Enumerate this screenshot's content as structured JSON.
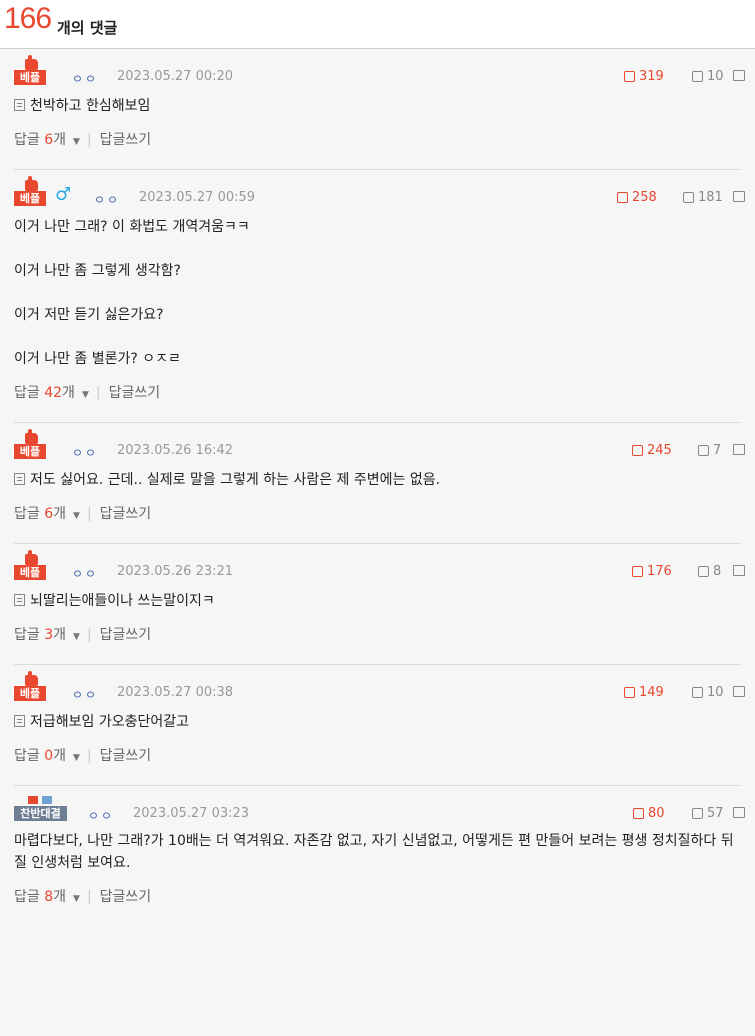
{
  "header": {
    "count": "166",
    "label": "개의 댓글"
  },
  "ui": {
    "reply_label": "답글",
    "reply_unit": "개",
    "write_reply": "답글쓰기",
    "best_badge": "베플",
    "flag_badge": "찬반대결"
  },
  "comments": [
    {
      "badge": "best",
      "gender": "",
      "nick": "ㅇㅇ",
      "date": "2023.05.27 00:20",
      "likes": "319",
      "dislikes": "10",
      "memo": true,
      "lines": [
        "천박하고 한심해보임"
      ],
      "replies": "6"
    },
    {
      "badge": "best",
      "gender": "♂",
      "nick": "ㅇㅇ",
      "date": "2023.05.27 00:59",
      "likes": "258",
      "dislikes": "181",
      "memo": false,
      "lines": [
        "이거 나만 그래? 이 화법도 개역겨움ㅋㅋ",
        "",
        "이거 나만 좀 그렇게 생각함?",
        "",
        "이거 저만 듣기 싫은가요?",
        "",
        "이거 나만 좀 별론가? ㅇㅈㄹ"
      ],
      "replies": "42"
    },
    {
      "badge": "best",
      "gender": "",
      "nick": "ㅇㅇ",
      "date": "2023.05.26 16:42",
      "likes": "245",
      "dislikes": "7",
      "memo": true,
      "lines": [
        "저도 싫어요. 근데.. 실제로 말을 그렇게 하는 사람은 제 주변에는 없음."
      ],
      "replies": "6"
    },
    {
      "badge": "best",
      "gender": "",
      "nick": "ㅇㅇ",
      "date": "2023.05.26 23:21",
      "likes": "176",
      "dislikes": "8",
      "memo": true,
      "lines": [
        "뇌딸리는애들이나 쓰는말이지ㅋ"
      ],
      "replies": "3"
    },
    {
      "badge": "best",
      "gender": "",
      "nick": "ㅇㅇ",
      "date": "2023.05.27 00:38",
      "likes": "149",
      "dislikes": "10",
      "memo": true,
      "lines": [
        "저급해보임 가오충단어갈고"
      ],
      "replies": "0"
    },
    {
      "badge": "flag",
      "gender": "",
      "nick": "ㅇㅇ",
      "date": "2023.05.27 03:23",
      "likes": "80",
      "dislikes": "57",
      "memo": false,
      "lines": [
        "마렵다보다, 나만 그래?가 10배는 더 역겨워요. 자존감 없고, 자기 신념없고, 어떻게든 편 만들어 보려는 평생 정치질하다 뒤질 인생처럼 보여요."
      ],
      "replies": "8"
    }
  ]
}
